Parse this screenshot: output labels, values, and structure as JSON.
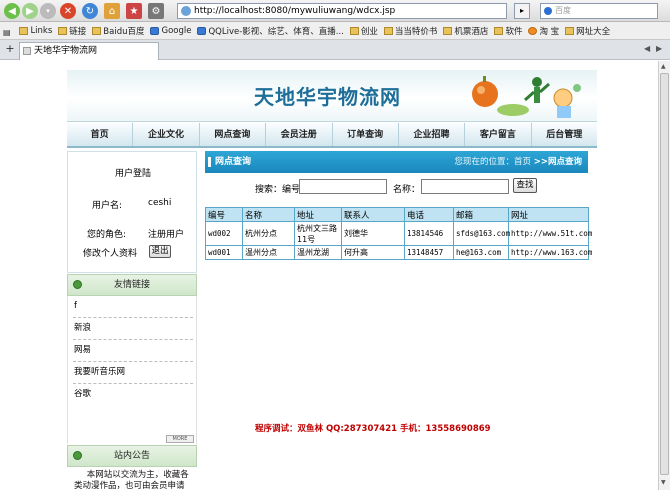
{
  "browser": {
    "url": "http://localhost:8080/mywuliuwang/wdcx.jsp",
    "search_placeholder": "百度",
    "go_label": "▸",
    "tab_title": "天地华宇物流网",
    "tab_new": "+",
    "bookmarks": [
      {
        "label": "Links",
        "icon": "folder-icon"
      },
      {
        "label": "链接",
        "icon": "folder-icon"
      },
      {
        "label": "Baidu百度",
        "icon": "folder-icon"
      },
      {
        "label": "Google",
        "icon": "google-icon"
      },
      {
        "label": "QQLive-影视、综艺、体育、直播...",
        "icon": "qq-icon"
      },
      {
        "label": "创业",
        "icon": "folder-icon"
      },
      {
        "label": "当当特价书",
        "icon": "folder-icon"
      },
      {
        "label": "机票酒店",
        "icon": "folder-icon"
      },
      {
        "label": "软件",
        "icon": "folder-icon"
      },
      {
        "label": "淘 宝",
        "icon": "taobao-icon"
      },
      {
        "label": "网址大全",
        "icon": "folder-icon"
      }
    ]
  },
  "site": {
    "title": "天地华宇物流网",
    "menu": [
      "首页",
      "企业文化",
      "网点查询",
      "会员注册",
      "订单查询",
      "企业招聘",
      "客户留言",
      "后台管理"
    ]
  },
  "login": {
    "title": "用户登陆",
    "username_label": "用户名:",
    "username_value": "ceshi",
    "role_label": "您的角色:",
    "role_value": "注册用户",
    "profile_link": "修改个人资料",
    "logout_label": "退出"
  },
  "friend_links": {
    "heading": "友情链接",
    "items": [
      "f",
      "新浪",
      "网易",
      "我要听音乐网",
      "谷歌"
    ],
    "more_label": "MORE"
  },
  "notice": {
    "heading": "站内公告",
    "text": "本网站以交流为主，收藏各类动漫作品，也可由会员申请自行上传，有意者敬请联系管理员。"
  },
  "main": {
    "title": "网点查询",
    "breadcrumb_prefix": "您现在的位置：首页",
    "breadcrumb_current": ">>网点查询",
    "search_code_label": "搜索：编号：",
    "search_code_value": "",
    "search_name_label": "名称：",
    "search_name_value": "",
    "search_button": "查找",
    "table": {
      "headers": [
        "编号",
        "名称",
        "地址",
        "联系人",
        "电话",
        "邮箱",
        "网址"
      ],
      "rows": [
        [
          "wd002",
          "杭州分点",
          "杭州文三路11号",
          "刘德华",
          "13814546",
          "sfds@163.com",
          "http://www.51t.com"
        ],
        [
          "wd001",
          "温州分点",
          "温州龙湖",
          "何升高",
          "13148457",
          "he@163.com",
          "http://www.163.com"
        ]
      ]
    },
    "credit": "程序调试：双鱼林 QQ:287307421 手机：13558690869"
  }
}
